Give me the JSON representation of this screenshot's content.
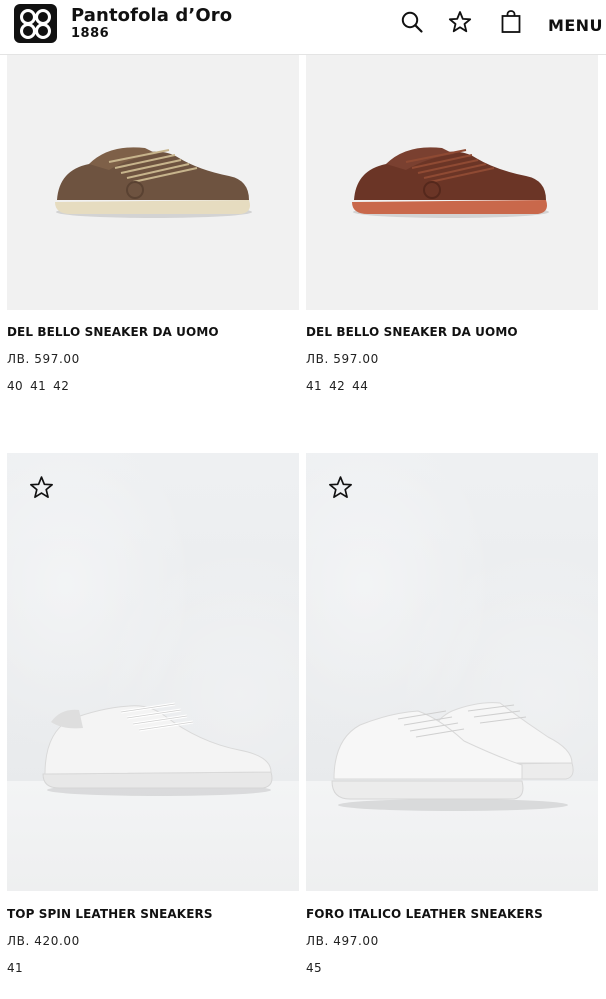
{
  "header": {
    "brand_name": "Pantofola d’Oro",
    "brand_year": "1886",
    "menu_label": "MENU",
    "icons": [
      "search-icon",
      "star-icon",
      "bag-icon"
    ]
  },
  "products": [
    {
      "name": "DEL BELLO SNEAKER DA UOMO",
      "price": "ЛВ. 597.00",
      "sizes": [
        "40",
        "41",
        "42"
      ],
      "colors": {
        "upper": "#6e5340",
        "sole": "#e6dcc0",
        "laces": "#c7b48c"
      }
    },
    {
      "name": "DEL BELLO SNEAKER DA UOMO",
      "price": "ЛВ. 597.00",
      "sizes": [
        "41",
        "42",
        "44"
      ],
      "colors": {
        "upper": "#6b3526",
        "sole": "#c9684b",
        "laces": "#8f4a33"
      }
    },
    {
      "name": "TOP SPIN LEATHER SNEAKERS",
      "price": "ЛВ. 420.00",
      "sizes": [
        "41"
      ],
      "colors": {
        "upper": "#f4f4f4",
        "sole": "#e8e8e8",
        "laces": "#ffffff"
      }
    },
    {
      "name": "FORO ITALICO LEATHER SNEAKERS",
      "price": "ЛВ. 497.00",
      "sizes": [
        "45"
      ],
      "colors": {
        "upper": "#f6f6f6",
        "sole": "#ececec",
        "laces": "#ffffff"
      }
    }
  ]
}
